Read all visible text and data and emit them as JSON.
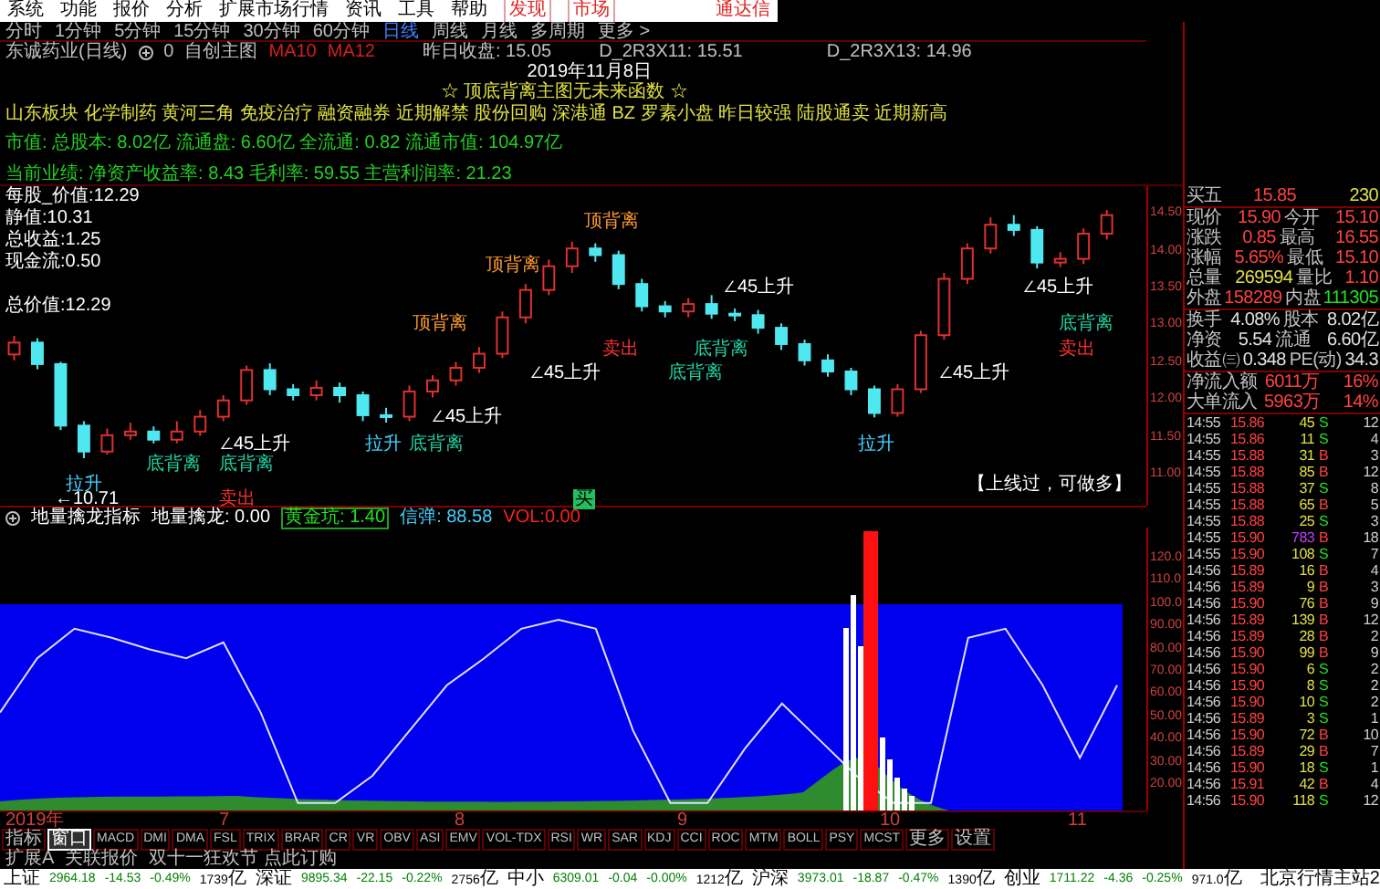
{
  "menu": [
    {
      "label": "系统",
      "kind": "normal"
    },
    {
      "label": "功能",
      "kind": "normal"
    },
    {
      "label": "报价",
      "kind": "normal"
    },
    {
      "label": "分析",
      "kind": "normal"
    },
    {
      "label": "扩展市场行情",
      "kind": "normal"
    },
    {
      "label": "资讯",
      "kind": "normal"
    },
    {
      "label": "工具",
      "kind": "normal"
    },
    {
      "label": "帮助",
      "kind": "normal"
    },
    {
      "label": "发现",
      "kind": "highlight"
    },
    {
      "label": "市场",
      "kind": "highlight"
    }
  ],
  "app_name": "通达信",
  "periods": [
    {
      "label": "分时",
      "selected": false
    },
    {
      "label": "1分钟",
      "selected": false
    },
    {
      "label": "5分钟",
      "selected": false
    },
    {
      "label": "15分钟",
      "selected": false
    },
    {
      "label": "30分钟",
      "selected": false
    },
    {
      "label": "60分钟",
      "selected": false
    },
    {
      "label": "日线",
      "selected": true
    },
    {
      "label": "周线",
      "selected": false
    },
    {
      "label": "月线",
      "selected": false
    },
    {
      "label": "多周期",
      "selected": false
    },
    {
      "label": "更多 >",
      "selected": false
    }
  ],
  "info": {
    "stock": "东诚药业(日线)",
    "count": "0",
    "template": "自创主图",
    "ma": [
      "MA10",
      "MA12"
    ],
    "prev_close": "昨日收盘: 15.05",
    "line_a": "D_2R3X11: 15.51",
    "line_b": "D_2R3X13: 14.96"
  },
  "date": "2019年11月8日",
  "formula_title": "☆ 顶底背离主图无未来函数 ☆",
  "concepts": "山东板块 化学制药 黄河三角 免疫治疗 融资融券 近期解禁 股份回购 深港通 BZ 罗素小盘 昨日较强 陆股通卖 近期新高",
  "market_line": "市值: 总股本: 8.02亿 流通盘: 6.60亿 全流通: 0.82 流通市值: 104.97亿",
  "performance_line": "当前业绩: 净资产收益率: 8.43 毛利率: 59.55 主营利润率: 21.23",
  "value_labels": [
    "每股_价值:12.29",
    "静值:10.31",
    "总收益:1.25",
    "现金流:0.50",
    "总价值:12.29"
  ],
  "main_chart": {
    "chart_data": {
      "type": "candlestick",
      "ylim": [
        10.56,
        14.87
      ],
      "ohlc": [
        [
          12.6,
          12.85,
          12.52,
          12.76
        ],
        [
          12.76,
          12.82,
          12.4,
          12.47
        ],
        [
          12.47,
          12.5,
          11.58,
          11.64
        ],
        [
          11.64,
          11.7,
          11.2,
          11.29
        ],
        [
          11.29,
          11.6,
          11.25,
          11.51
        ],
        [
          11.51,
          11.68,
          11.45,
          11.56
        ],
        [
          11.56,
          11.63,
          11.4,
          11.45
        ],
        [
          11.45,
          11.7,
          11.4,
          11.56
        ],
        [
          11.56,
          11.85,
          11.5,
          11.76
        ],
        [
          11.76,
          12.05,
          11.7,
          11.98
        ],
        [
          11.98,
          12.45,
          11.92,
          12.39
        ],
        [
          12.39,
          12.48,
          12.05,
          12.13
        ],
        [
          12.13,
          12.2,
          11.98,
          12.05
        ],
        [
          12.05,
          12.25,
          11.98,
          12.15
        ],
        [
          12.15,
          12.22,
          11.95,
          12.05
        ],
        [
          12.05,
          12.1,
          11.7,
          11.78
        ],
        [
          11.78,
          11.88,
          11.68,
          11.76
        ],
        [
          11.76,
          12.18,
          11.7,
          12.1
        ],
        [
          12.1,
          12.32,
          12.02,
          12.25
        ],
        [
          12.25,
          12.5,
          12.18,
          12.42
        ],
        [
          12.42,
          12.7,
          12.35,
          12.61
        ],
        [
          12.61,
          13.18,
          12.55,
          13.1
        ],
        [
          13.1,
          13.55,
          13.02,
          13.47
        ],
        [
          13.47,
          13.88,
          13.4,
          13.79
        ],
        [
          13.79,
          14.12,
          13.7,
          14.03
        ],
        [
          14.03,
          14.1,
          13.85,
          13.94
        ],
        [
          13.94,
          14.0,
          13.48,
          13.55
        ],
        [
          13.55,
          13.62,
          13.18,
          13.25
        ],
        [
          13.25,
          13.32,
          13.1,
          13.18
        ],
        [
          13.18,
          13.36,
          13.1,
          13.28
        ],
        [
          13.28,
          13.4,
          13.08,
          13.15
        ],
        [
          13.15,
          13.22,
          13.05,
          13.13
        ],
        [
          13.13,
          13.2,
          12.88,
          12.96
        ],
        [
          12.96,
          13.02,
          12.66,
          12.74
        ],
        [
          12.74,
          12.8,
          12.45,
          12.52
        ],
        [
          12.52,
          12.6,
          12.3,
          12.37
        ],
        [
          12.37,
          12.42,
          12.05,
          12.13
        ],
        [
          12.13,
          12.18,
          11.75,
          11.81
        ],
        [
          11.81,
          12.2,
          11.76,
          12.13
        ],
        [
          12.13,
          12.92,
          12.08,
          12.86
        ],
        [
          12.86,
          13.7,
          12.8,
          13.62
        ],
        [
          13.62,
          14.1,
          13.55,
          14.03
        ],
        [
          14.03,
          14.45,
          13.96,
          14.35
        ],
        [
          14.35,
          14.48,
          14.2,
          14.28
        ],
        [
          14.28,
          14.33,
          13.76,
          13.84
        ],
        [
          13.84,
          13.98,
          13.78,
          13.89
        ],
        [
          13.89,
          14.3,
          13.82,
          14.23
        ],
        [
          14.23,
          14.55,
          14.15,
          14.48
        ]
      ],
      "yticks": [
        {
          "value": 14.5,
          "label": "14.50"
        },
        {
          "value": 14,
          "label": "14.00"
        },
        {
          "value": 13.5,
          "label": "13.50"
        },
        {
          "value": 13,
          "label": "13.00"
        },
        {
          "value": 12.5,
          "label": "12.50"
        },
        {
          "value": 12,
          "label": "12.00"
        },
        {
          "value": 11.5,
          "label": "11.50"
        },
        {
          "value": 11,
          "label": "11.00"
        }
      ]
    }
  },
  "annotations": [
    {
      "text": "顶背离",
      "kind": "top"
    },
    {
      "text": "顶背离",
      "kind": "top"
    },
    {
      "text": "∠45上升",
      "kind": "rise"
    },
    {
      "text": "∠45上升",
      "kind": "rise"
    },
    {
      "text": "顶背离",
      "kind": "top"
    },
    {
      "text": "底背离",
      "kind": "bottom"
    },
    {
      "text": "卖出",
      "kind": "sell"
    },
    {
      "text": "底背离",
      "kind": "bottom"
    },
    {
      "text": "卖出",
      "kind": "sell"
    },
    {
      "text": "∠45上升",
      "kind": "rise"
    },
    {
      "text": "底背离",
      "kind": "bottom"
    },
    {
      "text": "∠45上升",
      "kind": "rise"
    },
    {
      "text": "∠45上升",
      "kind": "rise"
    },
    {
      "text": "∠45上升",
      "kind": "rise"
    },
    {
      "text": "拉升",
      "kind": "pull"
    },
    {
      "text": "底背离",
      "kind": "bottom"
    },
    {
      "text": "拉升",
      "kind": "pull"
    },
    {
      "text": "底背离",
      "kind": "bottom"
    },
    {
      "text": "底背离",
      "kind": "bottom"
    },
    {
      "text": "拉升",
      "kind": "pull"
    },
    {
      "text": "【上线过，可做多】",
      "kind": "signal"
    },
    {
      "text": "←10.71",
      "kind": "rise"
    },
    {
      "text": "卖出",
      "kind": "sell"
    },
    {
      "text": "买",
      "kind": "buy"
    }
  ],
  "indicator": {
    "name": "地量擒龙指标",
    "values": [
      {
        "text": "地量擒龙: 0.00",
        "kind": "plain"
      },
      {
        "text": "黄金坑: 1.40",
        "kind": "boxed"
      },
      {
        "text": "信弹: 88.58",
        "kind": "cyan"
      },
      {
        "text": "VOL:0.00",
        "kind": "red"
      }
    ],
    "chart_data": {
      "type": "line",
      "ylim": [
        8.71,
        133.71
      ],
      "series": [
        {
          "color": "#e0e0ff",
          "values": [
            52,
            76,
            89,
            85,
            80,
            76,
            83,
            52,
            12,
            12,
            24,
            44,
            64,
            76,
            89,
            93,
            89,
            44,
            12,
            12,
            36,
            56,
            40,
            24,
            12,
            12,
            85,
            89,
            64,
            32,
            64
          ]
        }
      ],
      "yticks": [
        {
          "value": 120,
          "label": "120.0"
        },
        {
          "value": 110,
          "label": "110.0"
        },
        {
          "value": 100,
          "label": "100.0"
        },
        {
          "value": 90,
          "label": "90.00"
        },
        {
          "value": 80,
          "label": "80.00"
        },
        {
          "value": 70,
          "label": "70.00"
        },
        {
          "value": 60,
          "label": "60.00"
        },
        {
          "value": 50,
          "label": "50.00"
        },
        {
          "value": 40,
          "label": "40.00"
        },
        {
          "value": 30,
          "label": "30.00"
        },
        {
          "value": 20,
          "label": "20.00"
        }
      ]
    }
  },
  "x_axis": [
    "2019年",
    "7",
    "8",
    "9",
    "10",
    "11"
  ],
  "indicator_tabs": [
    {
      "label": "指标",
      "selected": false
    },
    {
      "label": "窗口",
      "selected": true
    },
    {
      "label": "MACD",
      "selected": false
    },
    {
      "label": "DMI",
      "selected": false
    },
    {
      "label": "DMA",
      "selected": false
    },
    {
      "label": "FSL",
      "selected": false
    },
    {
      "label": "TRIX",
      "selected": false
    },
    {
      "label": "BRAR",
      "selected": false
    },
    {
      "label": "CR",
      "selected": false
    },
    {
      "label": "VR",
      "selected": false
    },
    {
      "label": "OBV",
      "selected": false
    },
    {
      "label": "ASI",
      "selected": false
    },
    {
      "label": "EMV",
      "selected": false
    },
    {
      "label": "VOL-TDX",
      "selected": false
    },
    {
      "label": "RSI",
      "selected": false
    },
    {
      "label": "WR",
      "selected": false
    },
    {
      "label": "SAR",
      "selected": false
    },
    {
      "label": "KDJ",
      "selected": false
    },
    {
      "label": "CCI",
      "selected": false
    },
    {
      "label": "ROC",
      "selected": false
    },
    {
      "label": "MTM",
      "selected": false
    },
    {
      "label": "BOLL",
      "selected": false
    },
    {
      "label": "PSY",
      "selected": false
    },
    {
      "label": "MCST",
      "selected": false
    },
    {
      "label": "更多",
      "selected": false
    },
    {
      "label": "设置",
      "selected": false
    }
  ],
  "extension": [
    "扩展A",
    "关联报价",
    "双十一狂欢节 点此订购"
  ],
  "quote_sections": [
    [
      {
        "label": "买五",
        "value": {
          "text": "15.85",
          "color": "#ff4040"
        },
        "value2": {
          "text": "230",
          "color": "#e0e040"
        }
      }
    ],
    [
      {
        "label": "现价",
        "value": {
          "text": "15.90",
          "color": "#ff4040"
        },
        "label2": "今开",
        "value2": {
          "text": "15.10",
          "color": "#ff4040"
        }
      },
      {
        "label": "涨跌",
        "value": {
          "text": "0.85",
          "color": "#ff4040"
        },
        "label2": "最高",
        "value2": {
          "text": "16.55",
          "color": "#ff4040"
        }
      },
      {
        "label": "涨幅",
        "value": {
          "text": "5.65%",
          "color": "#ff4040"
        },
        "label2": "最低",
        "value2": {
          "text": "15.10",
          "color": "#ff4040"
        }
      },
      {
        "label": "总量",
        "value": {
          "text": "269594",
          "color": "#e0e040"
        },
        "label2": "量比",
        "value2": {
          "text": "1.10",
          "color": "#ff4040"
        }
      },
      {
        "label": "外盘",
        "value": {
          "text": "158289",
          "color": "#ff4040"
        },
        "label2": "内盘",
        "value2": {
          "text": "111305",
          "color": "#20e020"
        }
      }
    ],
    [
      {
        "label": "换手",
        "value": {
          "text": "4.08%",
          "color": "#e0e0e0"
        },
        "label2": "股本",
        "value2": {
          "text": "8.02亿",
          "color": "#e0e0e0"
        }
      },
      {
        "label": "净资",
        "value": {
          "text": "5.54",
          "color": "#e0e0e0"
        },
        "label2": "流通",
        "value2": {
          "text": "6.60亿",
          "color": "#e0e0e0"
        }
      },
      {
        "label": "收益㈢",
        "value": {
          "text": "0.348",
          "color": "#e0e0e0"
        },
        "label2": "PE(动)",
        "value2": {
          "text": "34.3",
          "color": "#e0e0e0"
        }
      }
    ],
    [
      {
        "label": "净流入额",
        "value": {
          "text": "6011万",
          "color": "#ff4040"
        },
        "value2": {
          "text": "16%",
          "color": "#ff4040"
        }
      },
      {
        "label": "大单流入",
        "value": {
          "text": "5963万",
          "color": "#ff4040"
        },
        "value2": {
          "text": "14%",
          "color": "#ff4040"
        }
      }
    ]
  ],
  "trades": [
    {
      "time": "14:55",
      "price": "15.86",
      "volume": "45",
      "side": "S",
      "kind": "sell",
      "large": false,
      "count": "12"
    },
    {
      "time": "14:55",
      "price": "15.86",
      "volume": "11",
      "side": "S",
      "kind": "sell",
      "large": false,
      "count": "4"
    },
    {
      "time": "14:55",
      "price": "15.88",
      "volume": "31",
      "side": "B",
      "kind": "buy",
      "large": false,
      "count": "3"
    },
    {
      "time": "14:55",
      "price": "15.88",
      "volume": "85",
      "side": "B",
      "kind": "buy",
      "large": false,
      "count": "12"
    },
    {
      "time": "14:55",
      "price": "15.88",
      "volume": "37",
      "side": "S",
      "kind": "sell",
      "large": false,
      "count": "8"
    },
    {
      "time": "14:55",
      "price": "15.88",
      "volume": "65",
      "side": "B",
      "kind": "buy",
      "large": false,
      "count": "5"
    },
    {
      "time": "14:55",
      "price": "15.88",
      "volume": "25",
      "side": "S",
      "kind": "sell",
      "large": false,
      "count": "3"
    },
    {
      "time": "14:55",
      "price": "15.90",
      "volume": "783",
      "side": "B",
      "kind": "buy",
      "large": true,
      "count": "18"
    },
    {
      "time": "14:55",
      "price": "15.90",
      "volume": "108",
      "side": "S",
      "kind": "sell",
      "large": false,
      "count": "7"
    },
    {
      "time": "14:56",
      "price": "15.89",
      "volume": "16",
      "side": "B",
      "kind": "buy",
      "large": false,
      "count": "4"
    },
    {
      "time": "14:56",
      "price": "15.89",
      "volume": "9",
      "side": "B",
      "kind": "buy",
      "large": false,
      "count": "3"
    },
    {
      "time": "14:56",
      "price": "15.90",
      "volume": "76",
      "side": "B",
      "kind": "buy",
      "large": false,
      "count": "9"
    },
    {
      "time": "14:56",
      "price": "15.89",
      "volume": "139",
      "side": "B",
      "kind": "buy",
      "large": false,
      "count": "12"
    },
    {
      "time": "14:56",
      "price": "15.89",
      "volume": "28",
      "side": "B",
      "kind": "buy",
      "large": false,
      "count": "2"
    },
    {
      "time": "14:56",
      "price": "15.90",
      "volume": "99",
      "side": "B",
      "kind": "buy",
      "large": false,
      "count": "9"
    },
    {
      "time": "14:56",
      "price": "15.90",
      "volume": "6",
      "side": "S",
      "kind": "sell",
      "large": false,
      "count": "2"
    },
    {
      "time": "14:56",
      "price": "15.90",
      "volume": "8",
      "side": "S",
      "kind": "sell",
      "large": false,
      "count": "2"
    },
    {
      "time": "14:56",
      "price": "15.90",
      "volume": "10",
      "side": "S",
      "kind": "sell",
      "large": false,
      "count": "2"
    },
    {
      "time": "14:56",
      "price": "15.89",
      "volume": "3",
      "side": "S",
      "kind": "sell",
      "large": false,
      "count": "1"
    },
    {
      "time": "14:56",
      "price": "15.90",
      "volume": "72",
      "side": "B",
      "kind": "buy",
      "large": false,
      "count": "10"
    },
    {
      "time": "14:56",
      "price": "15.89",
      "volume": "29",
      "side": "B",
      "kind": "buy",
      "large": false,
      "count": "7"
    },
    {
      "time": "14:56",
      "price": "15.90",
      "volume": "18",
      "side": "S",
      "kind": "sell",
      "large": false,
      "count": "1"
    },
    {
      "time": "14:56",
      "price": "15.91",
      "volume": "42",
      "side": "B",
      "kind": "buy",
      "large": false,
      "count": "4"
    },
    {
      "time": "14:56",
      "price": "15.90",
      "volume": "118",
      "side": "S",
      "kind": "sell",
      "large": false,
      "count": "12"
    }
  ],
  "indices": [
    {
      "name": "上证",
      "value": "2964.18",
      "change": "-14.53",
      "percent": "-0.49%",
      "amount": "1739",
      "unit": "亿"
    },
    {
      "name": "深证",
      "value": "9895.34",
      "change": "-22.15",
      "percent": "-0.22%",
      "amount": "2756",
      "unit": "亿"
    },
    {
      "name": "中小",
      "value": "6309.01",
      "change": "-0.04",
      "percent": "-0.00%",
      "amount": "1212",
      "unit": "亿"
    },
    {
      "name": "沪深",
      "value": "3973.01",
      "change": "-18.87",
      "percent": "-0.47%",
      "amount": "1390",
      "unit": "亿"
    },
    {
      "name": "创业",
      "value": "1711.22",
      "change": "-4.36",
      "percent": "-0.25%",
      "amount": "971.0",
      "unit": "亿"
    }
  ],
  "server": "北京行情主站2"
}
